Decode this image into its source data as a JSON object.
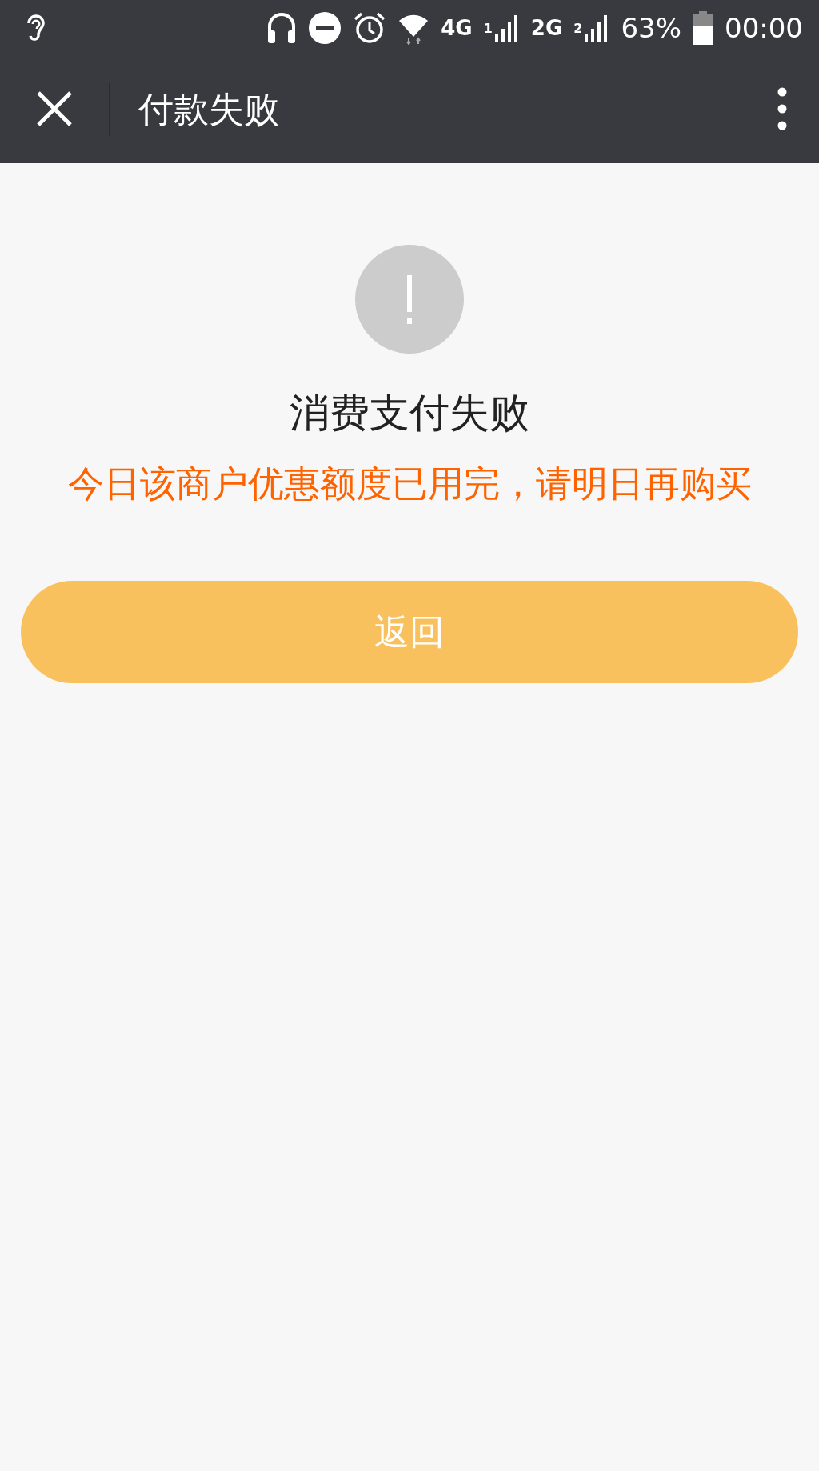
{
  "status_bar": {
    "network_1": "4G",
    "sim_1": "1",
    "network_2": "2G",
    "sim_2": "2",
    "battery": "63%",
    "time": "00:00"
  },
  "nav_bar": {
    "title": "付款失败"
  },
  "result": {
    "title": "消费支付失败",
    "message": "今日该商户优惠额度已用完，请明日再购买",
    "button": "返回"
  }
}
